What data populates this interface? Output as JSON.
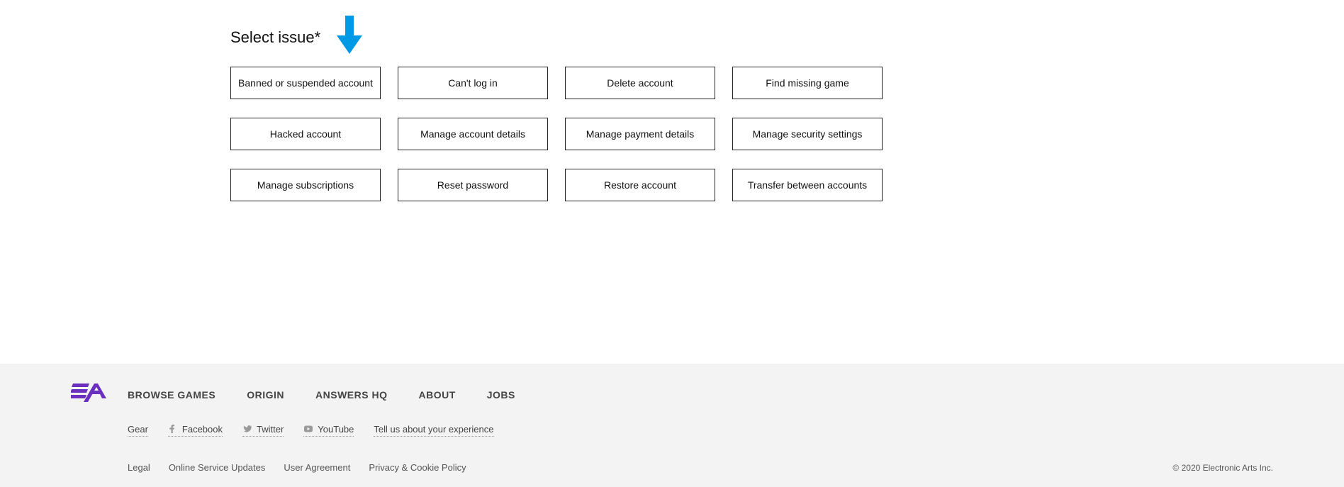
{
  "heading": "Select issue*",
  "options": [
    "Banned or suspended account",
    "Can't log in",
    "Delete account",
    "Find missing game",
    "Hacked account",
    "Manage account details",
    "Manage payment details",
    "Manage security settings",
    "Manage subscriptions",
    "Reset password",
    "Restore account",
    "Transfer between accounts"
  ],
  "footer": {
    "nav": [
      "BROWSE GAMES",
      "ORIGIN",
      "ANSWERS HQ",
      "ABOUT",
      "JOBS"
    ],
    "social": {
      "gear": "Gear",
      "facebook": "Facebook",
      "twitter": "Twitter",
      "youtube": "YouTube",
      "feedback": "Tell us about your experience"
    },
    "legal_links": [
      "Legal",
      "Online Service Updates",
      "User Agreement",
      "Privacy & Cookie Policy"
    ],
    "copyright": "© 2020 Electronic Arts Inc."
  }
}
